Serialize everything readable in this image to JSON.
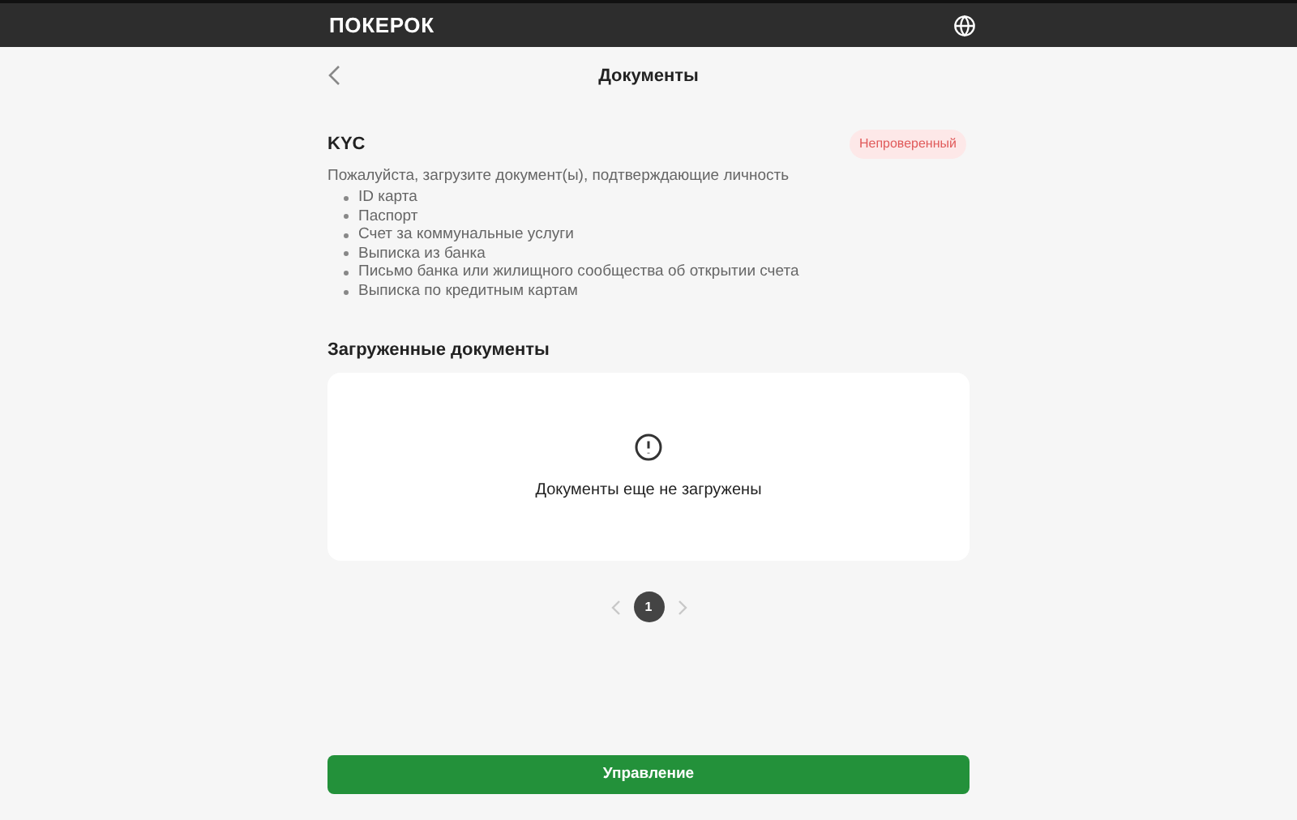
{
  "header": {
    "logo": "ПОКЕРОК"
  },
  "page": {
    "title": "Документы"
  },
  "kyc": {
    "title": "KYC",
    "status": "Непроверенный",
    "intro": "Пожалуйста, загрузите документ(ы), подтверждающие личность",
    "documents": [
      "ID карта",
      "Паспорт",
      "Счет за коммунальные услуги",
      "Выписка из банка",
      "Письмо банка или жилищного сообщества об открытии счета",
      "Выписка по кредитным картам"
    ]
  },
  "uploaded": {
    "title": "Загруженные документы",
    "empty_message": "Документы еще не загружены"
  },
  "pagination": {
    "pages": [
      {
        "label": "1",
        "selected": true
      }
    ],
    "prev_disabled": true,
    "next_disabled": true
  },
  "action_button": "Управление"
}
